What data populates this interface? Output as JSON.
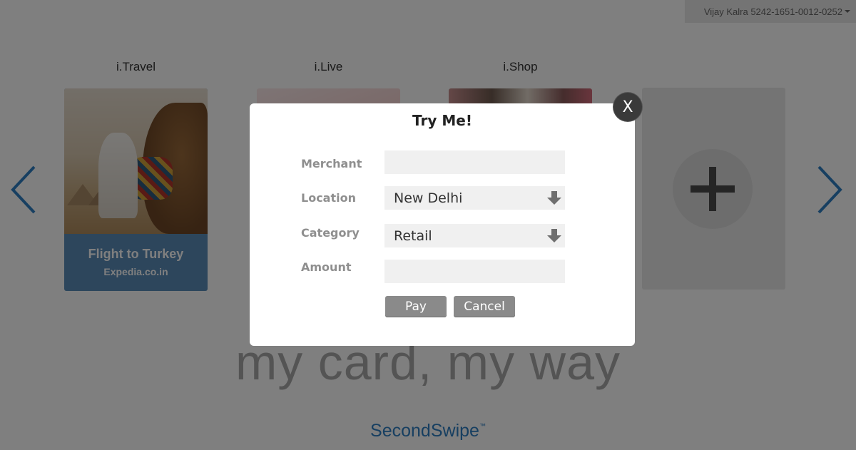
{
  "header": {
    "user_account": "Vijay Kalra 5242-1651-0012-0252"
  },
  "carousel": {
    "cards": [
      {
        "label": "i.Travel",
        "title": "Flight to Turkey",
        "subtitle": "Expedia.co.in"
      },
      {
        "label": "i.Live"
      },
      {
        "label": "i.Shop"
      }
    ]
  },
  "tagline": "my card, my way",
  "brand": {
    "name": "SecondSwipe",
    "trademark": "™"
  },
  "modal": {
    "title": "Try Me!",
    "close_label": "X",
    "fields": {
      "merchant_label": "Merchant",
      "merchant_value": "",
      "location_label": "Location",
      "location_value": "New Delhi",
      "category_label": "Category",
      "category_value": "Retail",
      "amount_label": "Amount",
      "amount_value": ""
    },
    "pay_label": "Pay",
    "cancel_label": "Cancel"
  },
  "colors": {
    "brand_blue": "#2f7fc2",
    "travel_card": "#5b8db9",
    "button_gray": "#8a8a8a"
  }
}
